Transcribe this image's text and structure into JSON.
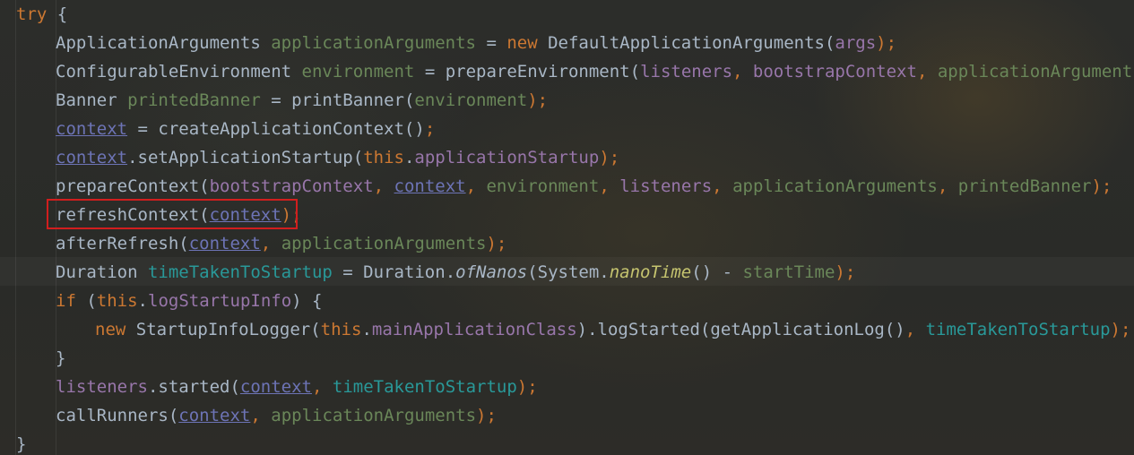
{
  "editor": {
    "lines": [
      {
        "indent": 0,
        "tokens": [
          {
            "t": "try",
            "c": "kw"
          },
          {
            "t": " {",
            "c": "p"
          }
        ]
      },
      {
        "indent": 1,
        "tokens": [
          {
            "t": "ApplicationArguments ",
            "c": "p"
          },
          {
            "t": "applicationArguments",
            "c": "lg"
          },
          {
            "t": " = ",
            "c": "p"
          },
          {
            "t": "new ",
            "c": "kw"
          },
          {
            "t": "DefaultApplicationArguments(",
            "c": "p"
          },
          {
            "t": "args",
            "c": "lv"
          },
          {
            "t": ");",
            "c": "kw"
          }
        ]
      },
      {
        "indent": 1,
        "tokens": [
          {
            "t": "ConfigurableEnvironment ",
            "c": "p"
          },
          {
            "t": "environment",
            "c": "lg"
          },
          {
            "t": " = prepareEnvironment(",
            "c": "p"
          },
          {
            "t": "listeners",
            "c": "lv"
          },
          {
            "t": ", ",
            "c": "kw"
          },
          {
            "t": "bootstrapContext",
            "c": "lv"
          },
          {
            "t": ", ",
            "c": "kw"
          },
          {
            "t": "applicationArguments",
            "c": "lg"
          },
          {
            "t": ");",
            "c": "kw"
          }
        ]
      },
      {
        "indent": 1,
        "tokens": [
          {
            "t": "Banner ",
            "c": "p"
          },
          {
            "t": "printedBanner",
            "c": "lg"
          },
          {
            "t": " = printBanner(",
            "c": "p"
          },
          {
            "t": "environment",
            "c": "lg"
          },
          {
            "t": ");",
            "c": "kw"
          }
        ]
      },
      {
        "indent": 1,
        "tokens": [
          {
            "t": "context",
            "c": "ctx"
          },
          {
            "t": " = createApplicationContext()",
            "c": "p"
          },
          {
            "t": ";",
            "c": "kw"
          }
        ]
      },
      {
        "indent": 1,
        "tokens": [
          {
            "t": "context",
            "c": "ctx"
          },
          {
            "t": ".setApplicationStartup(",
            "c": "p"
          },
          {
            "t": "this",
            "c": "kw"
          },
          {
            "t": ".",
            "c": "p"
          },
          {
            "t": "applicationStartup",
            "c": "f"
          },
          {
            "t": ");",
            "c": "kw"
          }
        ]
      },
      {
        "indent": 1,
        "tokens": [
          {
            "t": "prepareContext(",
            "c": "p"
          },
          {
            "t": "bootstrapContext",
            "c": "lv"
          },
          {
            "t": ", ",
            "c": "kw"
          },
          {
            "t": "context",
            "c": "ctx"
          },
          {
            "t": ", ",
            "c": "kw"
          },
          {
            "t": "environment",
            "c": "lg"
          },
          {
            "t": ", ",
            "c": "kw"
          },
          {
            "t": "listeners",
            "c": "lv"
          },
          {
            "t": ", ",
            "c": "kw"
          },
          {
            "t": "applicationArguments",
            "c": "lg"
          },
          {
            "t": ", ",
            "c": "kw"
          },
          {
            "t": "printedBanner",
            "c": "lg"
          },
          {
            "t": ");",
            "c": "kw"
          }
        ]
      },
      {
        "indent": 1,
        "tokens": [
          {
            "t": "refreshContext(",
            "c": "p"
          },
          {
            "t": "context",
            "c": "ctx"
          },
          {
            "t": ");",
            "c": "kw"
          }
        ]
      },
      {
        "indent": 1,
        "tokens": [
          {
            "t": "afterRefresh(",
            "c": "p"
          },
          {
            "t": "context",
            "c": "ctx"
          },
          {
            "t": ", ",
            "c": "kw"
          },
          {
            "t": "applicationArguments",
            "c": "lg"
          },
          {
            "t": ");",
            "c": "kw"
          }
        ]
      },
      {
        "indent": 1,
        "tokens": [
          {
            "t": "Duration ",
            "c": "p"
          },
          {
            "t": "timeTakenToStartup",
            "c": "lt"
          },
          {
            "t": " = Duration.",
            "c": "p"
          },
          {
            "t": "ofNanos",
            "c": "it"
          },
          {
            "t": "(System.",
            "c": "p"
          },
          {
            "t": "nanoTime",
            "c": "vw"
          },
          {
            "t": "() - ",
            "c": "p"
          },
          {
            "t": "startTime",
            "c": "lg"
          },
          {
            "t": ");",
            "c": "kw"
          }
        ]
      },
      {
        "indent": 1,
        "tokens": [
          {
            "t": "if ",
            "c": "kw"
          },
          {
            "t": "(",
            "c": "p"
          },
          {
            "t": "this",
            "c": "kw"
          },
          {
            "t": ".",
            "c": "p"
          },
          {
            "t": "logStartupInfo",
            "c": "f"
          },
          {
            "t": ") {",
            "c": "p"
          }
        ]
      },
      {
        "indent": 2,
        "tokens": [
          {
            "t": "new ",
            "c": "kw"
          },
          {
            "t": "StartupInfoLogger(",
            "c": "p"
          },
          {
            "t": "this",
            "c": "kw"
          },
          {
            "t": ".",
            "c": "p"
          },
          {
            "t": "mainApplicationClass",
            "c": "f"
          },
          {
            "t": ").logStarted(getApplicationLog()",
            "c": "p"
          },
          {
            "t": ", ",
            "c": "kw"
          },
          {
            "t": "timeTakenToStartup",
            "c": "lt"
          },
          {
            "t": ");",
            "c": "kw"
          }
        ]
      },
      {
        "indent": 1,
        "tokens": [
          {
            "t": "}",
            "c": "p"
          }
        ]
      },
      {
        "indent": 1,
        "tokens": [
          {
            "t": "listeners",
            "c": "lv"
          },
          {
            "t": ".started(",
            "c": "p"
          },
          {
            "t": "context",
            "c": "ctx"
          },
          {
            "t": ", ",
            "c": "kw"
          },
          {
            "t": "timeTakenToStartup",
            "c": "lt"
          },
          {
            "t": ");",
            "c": "kw"
          }
        ]
      },
      {
        "indent": 1,
        "tokens": [
          {
            "t": "callRunners(",
            "c": "p"
          },
          {
            "t": "context",
            "c": "ctx"
          },
          {
            "t": ", ",
            "c": "kw"
          },
          {
            "t": "applicationArguments",
            "c": "lg"
          },
          {
            "t": ");",
            "c": "kw"
          }
        ]
      },
      {
        "indent": 0,
        "tokens": [
          {
            "t": "}",
            "c": "p"
          }
        ]
      }
    ],
    "highlighted_line": 7,
    "colors": {
      "keyword": "#cc7832",
      "field": "#9876aa",
      "local": "#6a8759",
      "plain": "#a9b7c6",
      "context": "#6d74b6",
      "highlight_box": "#d11e1e"
    }
  }
}
